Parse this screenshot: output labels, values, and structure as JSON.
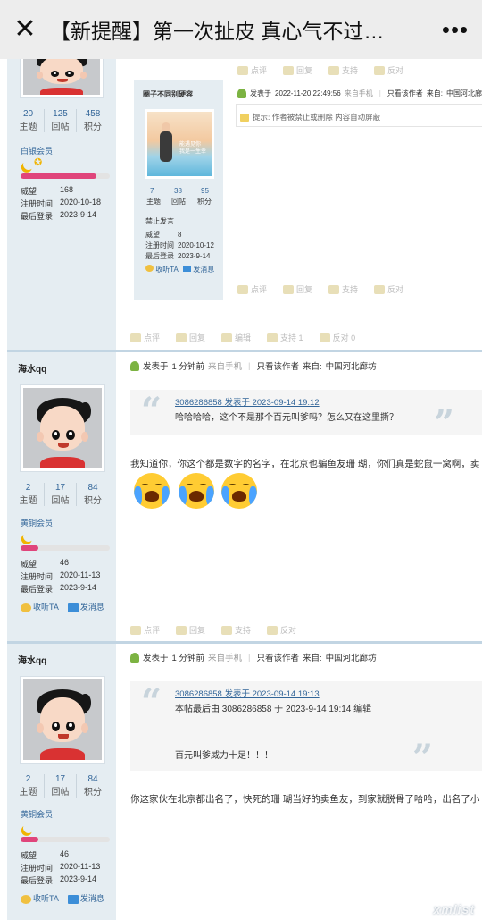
{
  "topbar": {
    "close_icon": "close-icon",
    "title": "【新提醒】第一次扯皮 真心气不过…",
    "more_icon": "more-dots-icon"
  },
  "post0": {
    "user_stats": [
      {
        "num": "20",
        "label": "主题"
      },
      {
        "num": "125",
        "label": "回帖"
      },
      {
        "num": "458",
        "label": "积分"
      }
    ],
    "rank": "白银会员",
    "level_progress": 0.85,
    "meta": [
      {
        "k": "威望",
        "v": "168"
      },
      {
        "k": "注册时间",
        "v": "2020-10-18"
      },
      {
        "k": "最后登录",
        "v": "2023-9-14"
      }
    ],
    "inner": {
      "username": "圈子不同别硬容",
      "head": {
        "prefix": "发表于",
        "time": "2022-11-20 22:49:56",
        "from": "来自手机",
        "only_author": "只看该作者",
        "source_label": "来自:",
        "source": "中国河北廊坊"
      },
      "tip": "提示: 作者被禁止或删除 内容自动屏蔽",
      "image_text": [
        "能遇见你",
        "我是一生幸"
      ],
      "stats": [
        {
          "num": "7",
          "label": "主题"
        },
        {
          "num": "38",
          "label": "回帖"
        },
        {
          "num": "95",
          "label": "积分"
        }
      ],
      "status": "禁止发言",
      "meta": [
        {
          "k": "威望",
          "v": "8"
        },
        {
          "k": "注册时间",
          "v": "2020-10-12"
        },
        {
          "k": "最后登录",
          "v": "2023-9-14"
        }
      ],
      "collect": "收听TA",
      "message": "发消息",
      "actions_top": [
        "点评",
        "回复",
        "支持",
        "反对"
      ],
      "actions_bottom": [
        "点评",
        "回复",
        "支持",
        "反对"
      ]
    },
    "actions": [
      "点评",
      "回复",
      "编辑",
      "支持 1",
      "反对 0"
    ]
  },
  "post1": {
    "username": "海水qq",
    "head": {
      "prefix": "发表于",
      "time": "1 分钟前",
      "from": "来自手机",
      "only_author": "只看该作者",
      "source_label": "来自:",
      "source": "中国河北廊坊"
    },
    "quote_head": "3086286858 发表于 2023-09-14 19:12",
    "quote_text": "哈哈哈哈，这个不是那个百元叫爹吗？怎么又在这里撕？",
    "content": "我知道你，你这个都是数字的名字，在北京也骗鱼友珊 瑚，你们真是蛇鼠一窝啊，卖",
    "user_stats": [
      {
        "num": "2",
        "label": "主题"
      },
      {
        "num": "17",
        "label": "回帖"
      },
      {
        "num": "84",
        "label": "积分"
      }
    ],
    "rank": "黄铜会员",
    "level_progress": 0.2,
    "meta": [
      {
        "k": "威望",
        "v": "46"
      },
      {
        "k": "注册时间",
        "v": "2020-11-13"
      },
      {
        "k": "最后登录",
        "v": "2023-9-14"
      }
    ],
    "collect": "收听TA",
    "message": "发消息",
    "actions": [
      "点评",
      "回复",
      "支持",
      "反对"
    ]
  },
  "post2": {
    "username": "海水qq",
    "head": {
      "prefix": "发表于",
      "time": "1 分钟前",
      "from": "来自手机",
      "only_author": "只看该作者",
      "source_label": "来自:",
      "source": "中国河北廊坊"
    },
    "quote_head": "3086286858 发表于 2023-09-14 19:13",
    "quote_edit": "本帖最后由 3086286858 于 2023-9-14 19:14 编辑",
    "quote_text": "百元叫爹威力十足！！！",
    "content": "你这家伙在北京都出名了，快死的珊 瑚当好的卖鱼友，到家就脱骨了哈哈，出名了小",
    "user_stats": [
      {
        "num": "2",
        "label": "主题"
      },
      {
        "num": "17",
        "label": "回帖"
      },
      {
        "num": "84",
        "label": "积分"
      }
    ],
    "rank": "黄铜会员",
    "level_progress": 0.2,
    "meta": [
      {
        "k": "威望",
        "v": "46"
      },
      {
        "k": "注册时间",
        "v": "2020-11-13"
      },
      {
        "k": "最后登录",
        "v": "2023-9-14"
      }
    ],
    "collect": "收听TA",
    "message": "发消息"
  },
  "watermark": "xmlist"
}
